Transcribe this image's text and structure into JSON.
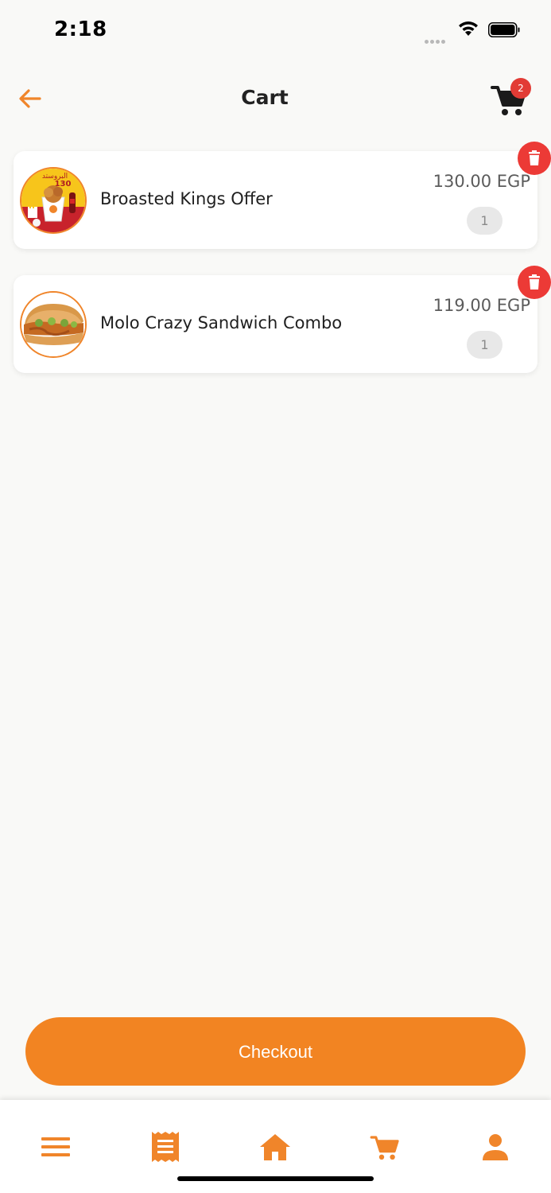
{
  "status_bar": {
    "time": "2:18"
  },
  "header": {
    "title": "Cart",
    "cart_badge": "2",
    "back_icon": "arrow-left-icon",
    "cart_icon": "cart-icon"
  },
  "cart": {
    "items": [
      {
        "name": "Broasted Kings Offer",
        "price": "130.00 EGP",
        "quantity": "1",
        "image_text": "130",
        "image_arabic": "البروستد"
      },
      {
        "name": "Molo Crazy Sandwich Combo",
        "price": "119.00 EGP",
        "quantity": "1"
      }
    ]
  },
  "checkout": {
    "label": "Checkout"
  },
  "bottom_nav": {
    "items": [
      "menu-icon",
      "receipt-icon",
      "home-icon",
      "cart-icon",
      "person-icon"
    ]
  },
  "colors": {
    "accent": "#f28422",
    "delete": "#ec3a36",
    "background": "#f9f9f7"
  }
}
